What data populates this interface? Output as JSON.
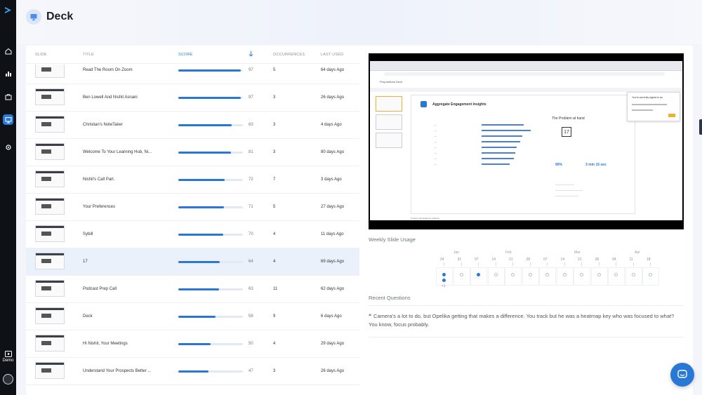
{
  "app": {
    "title": "Deck",
    "demo_label": "Demo"
  },
  "table": {
    "headers": {
      "slide": "SLIDE",
      "title": "TITLE",
      "score": "SCORE",
      "occurrences": "OCCURRENCES",
      "last_used": "LAST USED"
    },
    "rows": [
      {
        "title": "Read The Room On Zoom",
        "score": "97",
        "score_value": 97,
        "occurrences": "5",
        "last_used": "64 days Ago"
      },
      {
        "title": "Ben Lowell And Nishit Asnani",
        "score": "97",
        "score_value": 97,
        "occurrences": "3",
        "last_used": "26 days Ago"
      },
      {
        "title": "Christian's NoteTaker",
        "score": "83",
        "score_value": 83,
        "occurrences": "3",
        "last_used": "4 days Ago"
      },
      {
        "title": "Welcome To Your Learning Hub, Ni...",
        "score": "81",
        "score_value": 81,
        "occurrences": "3",
        "last_used": "80 days Ago"
      },
      {
        "title": "Nishit's Call Part.",
        "score": "72",
        "score_value": 72,
        "occurrences": "7",
        "last_used": "3 days Ago"
      },
      {
        "title": "Your Preferences",
        "score": "71",
        "score_value": 71,
        "occurrences": "5",
        "last_used": "27 days Ago"
      },
      {
        "title": "Sybill",
        "score": "70",
        "score_value": 70,
        "occurrences": "4",
        "last_used": "11 days Ago"
      },
      {
        "title": "17",
        "score": "64",
        "score_value": 64,
        "occurrences": "4",
        "last_used": "69 days Ago",
        "selected": true
      },
      {
        "title": "Podcast Prep Call",
        "score": "63",
        "score_value": 63,
        "occurrences": "11",
        "last_used": "62 days Ago"
      },
      {
        "title": "Deck",
        "score": "58",
        "score_value": 58,
        "occurrences": "9",
        "last_used": "6 days Ago"
      },
      {
        "title": "Hi Nishit, Your Meetings",
        "score": "50",
        "score_value": 50,
        "occurrences": "4",
        "last_used": "29 days Ago"
      },
      {
        "title": "Understand Your Prospects Better ...",
        "score": "47",
        "score_value": 47,
        "occurrences": "3",
        "last_used": "26 days Ago"
      }
    ]
  },
  "preview": {
    "app_title": "Propositions Deck",
    "slide_title": "Aggregate Engagement Insights",
    "problem_title": "The Problem at hand",
    "calendar_day": "17",
    "stat_1": "90%",
    "stat_2": "3 min 15 sec",
    "signed_in": "You're currently signed in as",
    "caption": "Context and audience analysis"
  },
  "weekly": {
    "title": "Weekly Slide Usage",
    "months": [
      "Jan",
      "Feb",
      "Mar",
      "Apr"
    ],
    "days": [
      "24",
      "31",
      "07",
      "14",
      "21",
      "28",
      "07",
      "14",
      "21",
      "28",
      "04",
      "11",
      "18"
    ],
    "plus_label": "+1"
  },
  "recent": {
    "title": "Recent Questions",
    "question": "Camera's a lot to do, but Opelika getting that makes a difference. You track but he was a heatmap key who was focused to what? You know, focus probably."
  },
  "colors": {
    "accent": "#2a78d6",
    "rail": "#0e1116",
    "selected_row": "#ebf1fb"
  },
  "icons": [
    "logo-icon",
    "home-icon",
    "analytics-icon",
    "briefcase-icon",
    "deck-icon",
    "gear-icon",
    "demo-icon",
    "chat-icon",
    "sort-arrow-icon",
    "quote-icon"
  ]
}
